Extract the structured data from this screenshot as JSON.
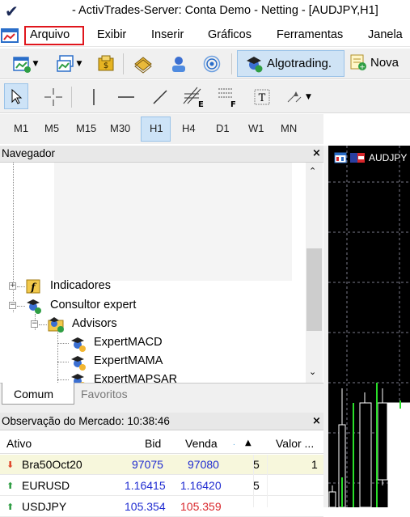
{
  "window": {
    "title": "- ActivTrades-Server: Conta Demo - Netting - [AUDJPY,H1]"
  },
  "menu": {
    "items": [
      "Arquivo",
      "Exibir",
      "Inserir",
      "Gráficos",
      "Ferramentas",
      "Janela"
    ],
    "highlight_color": "#e0151c"
  },
  "toolbar": {
    "algotrading_label": "Algotrading.",
    "new_order_label": "Nova"
  },
  "timeframes": {
    "items": [
      "M1",
      "M5",
      "M15",
      "M30",
      "H1",
      "H4",
      "D1",
      "W1",
      "MN"
    ],
    "selected": "H1"
  },
  "navigator": {
    "title": "Navegador",
    "items": {
      "indicators": "Indicadores",
      "expert_advisors": "Consultor expert",
      "advisors": "Advisors",
      "macd": "ExpertMACD",
      "mama": "ExpertMAMA",
      "mapsar": "ExpertMAPSAR"
    },
    "tabs": [
      "Comum",
      "Favoritos"
    ]
  },
  "market_watch": {
    "title": "Observação do Mercado: 10:38:46",
    "columns": [
      "Ativo",
      "Bid",
      "Venda",
      "",
      "Valor ..."
    ],
    "rows": [
      {
        "symbol": "Bra50Oct20",
        "bid": "97075",
        "ask": "97080",
        "spread": "5",
        "value": "1",
        "direction": "down"
      },
      {
        "symbol": "EURUSD",
        "bid": "1.16415",
        "ask": "1.16420",
        "spread": "5",
        "value": "",
        "direction": "up"
      },
      {
        "symbol": "USDJPY",
        "bid": "105.354",
        "ask": "105.359",
        "spread": "",
        "value": "",
        "direction": "up"
      }
    ]
  },
  "chart": {
    "symbol_label": "AUDJPY"
  }
}
